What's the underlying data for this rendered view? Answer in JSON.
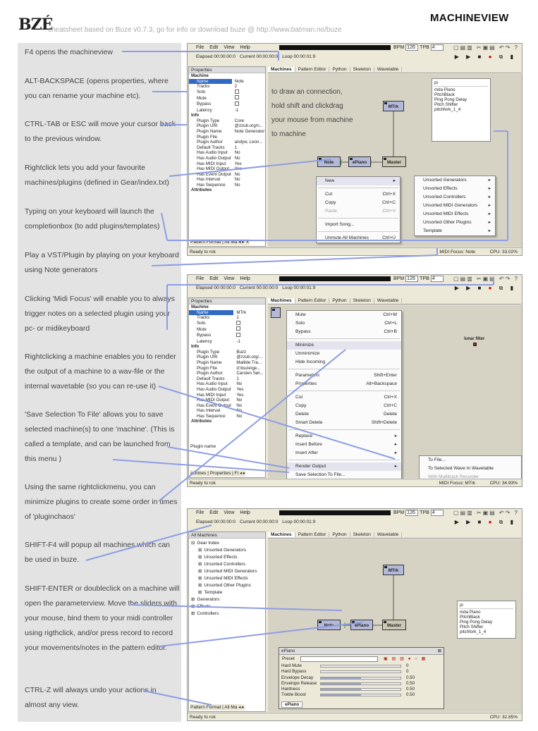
{
  "header": {
    "logo": "BZÉ",
    "subtitle": "cheatsheet based on Buze v0.7.3, go for info or download buze @ http://www.batman.no/buze",
    "title": "MACHINEVIEW"
  },
  "colors": {
    "note_panel": "#e3e3e3",
    "connector": "#8d9de3",
    "generator": "#b4b9d8",
    "effect": "#b7ceb0",
    "master": "#ccc6b4",
    "selection": "#316ac5"
  },
  "notes": [
    "F4 opens the machineview",
    "ALT-BACKSPACE (opens properties, where you can rename your machine etc).",
    "CTRL-TAB or ESC will move your cursor back to the previous window.",
    "Rightclick lets you add your favourite machines/plugins (defined in Gear/index.txt)",
    "Typing on your keyboard will launch the completionbox (to add plugins/templates)",
    "Play a VST/Plugin by playing on your keyboard using Note generators",
    "Clicking 'Midi Focus' will enable you to always trigger notes on a selected plugin using your pc- or midikeyboard",
    "Rightclicking a machine enables you to render the output of a machine to a wav-file or the internal wavetable (so you can re-use it)",
    "'Save Selection To File' allows you to save selected machine(s) to one 'machine'. (This is called a template, and can be launched from this menu  )",
    "Using the same rightclickmenu, you can minimize plugins to create some order in times of 'pluginchaos'",
    "SHIFT-F4 will popup all machines which can be used in buze.",
    "SHIFT-ENTER or doubleclick on a machine will open the parameterview. Move the sliders with your mouse, bind them to your midi controller using rigthclick, and/or press record to record your movements/notes in the pattern editor.",
    "CTRL-Z will always undo your actions in almost any view."
  ],
  "app": {
    "menu": [
      "File",
      "Edit",
      "View",
      "Help"
    ],
    "bpm_label": "BPM",
    "bpm": "126",
    "tpb_label": "TPB",
    "tpb": "4",
    "elapsed": "Elapsed 00:00:00:0",
    "current": "Current 00:00:00:0",
    "loop": "Loop 00:00:01:9",
    "status": "Ready to rok",
    "tabs": [
      "Machines",
      "Pattern Editor",
      "Python",
      "Skeleton",
      "Wavetable"
    ]
  },
  "shot1": {
    "properties_title": "Properties",
    "props": [
      {
        "k": "Machine",
        "v": "",
        "sec": true
      },
      {
        "k": "Name",
        "v": "Note",
        "sel": true
      },
      {
        "k": "Tracks",
        "v": "2"
      },
      {
        "k": "Solo",
        "v": "",
        "chk": true
      },
      {
        "k": "Mute",
        "v": "",
        "chk": true
      },
      {
        "k": "Bypass",
        "v": "",
        "chk": true
      },
      {
        "k": "Latency",
        "v": "-1"
      },
      {
        "k": "Info",
        "v": "",
        "sec": true
      },
      {
        "k": "Plugin Type",
        "v": "Core"
      },
      {
        "k": "Plugin URI",
        "v": "@zzub.org/n..."
      },
      {
        "k": "Plugin Name",
        "v": "Note Generator"
      },
      {
        "k": "Plugin File",
        "v": ""
      },
      {
        "k": "Plugin Author",
        "v": "andyw, Leon..."
      },
      {
        "k": "Default Tracks",
        "v": "1"
      },
      {
        "k": "Has Audio Input",
        "v": "No"
      },
      {
        "k": "Has Audio Output",
        "v": "No"
      },
      {
        "k": "Has MIDI Input",
        "v": "Yes"
      },
      {
        "k": "Has MIDI Output",
        "v": "Yes"
      },
      {
        "k": "Has Event Output",
        "v": "No"
      },
      {
        "k": "Has Interval",
        "v": "No"
      },
      {
        "k": "Has Sequence",
        "v": "No"
      },
      {
        "k": "Attributes",
        "v": "",
        "sec": true
      }
    ],
    "bottom_tabs": "Pattern Format | All Ma ◂ ▸ ✕",
    "canvas_text": [
      "to draw an connection,",
      "hold shift and clickdrag",
      "your mouse from machine",
      "to machine"
    ],
    "machines": {
      "mtrk": "MTrk",
      "note": "Note",
      "epiano": "ePiano",
      "master": "Master"
    },
    "completion_query": "pi",
    "completion_items": [
      "mda Piano",
      "PitchBlack",
      "Ping Pong Delay",
      "Pitch Shifter",
      "pitchfork_1_4"
    ],
    "menu": [
      {
        "label": "New",
        "sc": "▸",
        "hi": true
      },
      {
        "sep": true
      },
      {
        "label": "Cut",
        "sc": "Ctrl+X"
      },
      {
        "label": "Copy",
        "sc": "Ctrl+C"
      },
      {
        "label": "Paste",
        "sc": "Ctrl+V",
        "dis": true
      },
      {
        "sep": true
      },
      {
        "label": "Import Song..."
      },
      {
        "sep": true
      },
      {
        "label": "Unmute All Machines",
        "sc": "Ctrl+U"
      }
    ],
    "submenu": [
      "Unsorted Generators",
      "Unsorted Effects",
      "Unsorted Controllers",
      "Unsorted MIDI Generators",
      "Unsorted MIDI Effects",
      "Unsorted Other Plugins",
      "Template"
    ],
    "midi_focus": "MIDI Focus: Note",
    "cpu": "CPU: 33.02%"
  },
  "shot2": {
    "props": [
      {
        "k": "Machine",
        "v": "",
        "sec": true
      },
      {
        "k": "Name",
        "v": "MTrk",
        "sel": true
      },
      {
        "k": "Tracks",
        "v": "1"
      },
      {
        "k": "Solo",
        "v": "",
        "chk": true
      },
      {
        "k": "Mute",
        "v": "",
        "chk": true
      },
      {
        "k": "Bypass",
        "v": "",
        "chk": true
      },
      {
        "k": "Latency",
        "v": "-1"
      },
      {
        "k": "Info",
        "v": "",
        "sec": true
      },
      {
        "k": "Plugin Type",
        "v": "Buzz"
      },
      {
        "k": "Plugin URI",
        "v": "@zzub.org/..."
      },
      {
        "k": "Plugin Name",
        "v": "Matilde Tra..."
      },
      {
        "k": "Plugin File",
        "v": "d:\\buze\\ge..."
      },
      {
        "k": "Plugin Author",
        "v": "Carsten Sør..."
      },
      {
        "k": "Default Tracks",
        "v": "1"
      },
      {
        "k": "Has Audio Input",
        "v": "No"
      },
      {
        "k": "Has Audio Output",
        "v": "Yes"
      },
      {
        "k": "Has MIDI Input",
        "v": "Yes"
      },
      {
        "k": "Has MIDI Output",
        "v": "No"
      },
      {
        "k": "Has Event Output",
        "v": "No"
      },
      {
        "k": "Has Interval",
        "v": "No"
      },
      {
        "k": "Has Sequence",
        "v": "No"
      },
      {
        "k": "Attributes",
        "v": "",
        "sec": true
      }
    ],
    "plugin_name_label": "Plugin name",
    "bottom_tabs": "achines | Properties | Fi ◂ ▸",
    "lunar_filter": "lunar filter",
    "menu": [
      {
        "label": "Mute",
        "sc": "Ctrl+M"
      },
      {
        "label": "Solo",
        "sc": "Ctrl+L"
      },
      {
        "label": "Bypass",
        "sc": "Ctrl+B"
      },
      {
        "sep": true
      },
      {
        "label": "Minimize",
        "hi": true
      },
      {
        "label": "Unminimize"
      },
      {
        "label": "Hide Incoming"
      },
      {
        "sep": true
      },
      {
        "label": "Parameters",
        "sc": "Shift+Enter"
      },
      {
        "label": "Properties",
        "sc": "Alt+Backspace"
      },
      {
        "sep": true
      },
      {
        "label": "Cut",
        "sc": "Ctrl+X"
      },
      {
        "label": "Copy",
        "sc": "Ctrl+C"
      },
      {
        "label": "Delete",
        "sc": "Delete"
      },
      {
        "label": "Smart Delete",
        "sc": "Shift+Delete"
      },
      {
        "sep": true
      },
      {
        "label": "Replace",
        "sc": "▸"
      },
      {
        "label": "Insert Before",
        "sc": "▸"
      },
      {
        "label": "Insert After",
        "sc": "▸"
      },
      {
        "sep": true
      },
      {
        "label": "Render Output",
        "sc": "▸",
        "hi": true
      },
      {
        "label": "Save Selection To File..."
      },
      {
        "label": "Time Source",
        "sc": "▸"
      }
    ],
    "render_submenu": [
      {
        "label": "To File..."
      },
      {
        "label": "To Selected Wave In Wavetable"
      },
      {
        "label": "With Multitrack Recorder",
        "dis": true
      }
    ],
    "midi_focus": "MIDI Focus: MTrk",
    "cpu": "CPU: 34.93%"
  },
  "shot3": {
    "all_machines_title": "All Machines",
    "tree": [
      {
        "label": "Gear Index",
        "lvl": 0,
        "exp": "⊟"
      },
      {
        "label": "Unsorted Generators",
        "lvl": 1,
        "exp": "⊞"
      },
      {
        "label": "Unsorted Effects",
        "lvl": 1,
        "exp": "⊞"
      },
      {
        "label": "Unsorted Controllers",
        "lvl": 1,
        "exp": "⊞"
      },
      {
        "label": "Unsorted MIDI Generators",
        "lvl": 1,
        "exp": "⊞"
      },
      {
        "label": "Unsorted MIDI Effects",
        "lvl": 1,
        "exp": "⊞"
      },
      {
        "label": "Unsorted Other Plugins",
        "lvl": 1,
        "exp": "⊞"
      },
      {
        "label": "Template",
        "lvl": 1,
        "exp": "⊞"
      },
      {
        "label": "Generators",
        "lvl": 0,
        "exp": "⊞"
      },
      {
        "label": "Effects",
        "lvl": 0,
        "exp": "⊞"
      },
      {
        "label": "Controllers",
        "lvl": 0,
        "exp": "⊞"
      }
    ],
    "bottom_tabs": "Pattern Format | All Ma ◂ ▸",
    "param_title": "ePiano",
    "preset_label": "Preset",
    "params": [
      {
        "name": "Hard Mute",
        "val": "0",
        "level": 0.0
      },
      {
        "name": "Hard Bypass",
        "val": "0",
        "level": 0.0
      },
      {
        "name": "Envelope Decay",
        "val": "0.50",
        "level": 0.5
      },
      {
        "name": "Envelope Release",
        "val": "0.50",
        "level": 0.5
      },
      {
        "name": "Hardness",
        "val": "0.50",
        "level": 0.5
      },
      {
        "name": "Treble Boost",
        "val": "0.50",
        "level": 0.5
      }
    ],
    "param_tab": "ePiano",
    "cpu": "CPU: 32.85%"
  }
}
